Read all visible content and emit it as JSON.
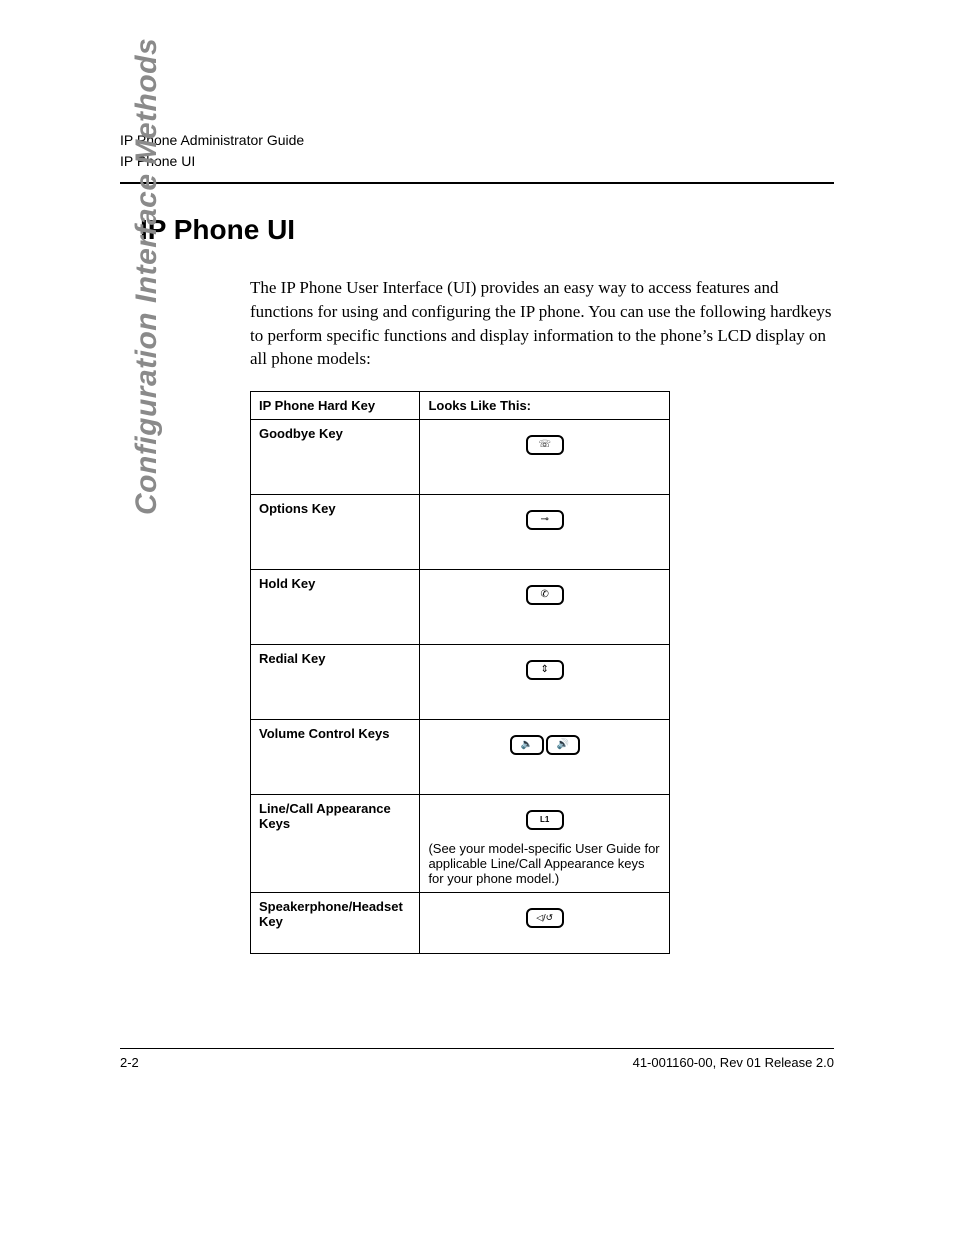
{
  "header": {
    "line1": "IP Phone Administrator Guide",
    "line2": "IP Phone UI"
  },
  "sidebar_label": "Configuration Interface Methods",
  "page_title": "IP Phone UI",
  "body_paragraph": "The IP Phone User Interface (UI) provides an easy way to access features and functions for using and configuring the IP phone. You can use the following hardkeys to perform specific functions and display information to the phone’s LCD display on all phone models:",
  "table": {
    "col1_header": "IP Phone Hard Key",
    "col2_header": "Looks Like This:",
    "rows": [
      {
        "label": "Goodbye Key",
        "icon": "goodbye",
        "note": ""
      },
      {
        "label": "Options Key",
        "icon": "options",
        "note": ""
      },
      {
        "label": "Hold Key",
        "icon": "hold",
        "note": ""
      },
      {
        "label": "Redial Key",
        "icon": "redial",
        "note": ""
      },
      {
        "label": "Volume Control Keys",
        "icon": "volume",
        "note": ""
      },
      {
        "label": "Line/Call Appearance Keys",
        "icon": "line",
        "note": "(See your model-specific User Guide for applicable Line/Call Appearance keys for your phone model.)"
      },
      {
        "label": "Speakerphone/Headset Key",
        "icon": "speaker",
        "note": ""
      }
    ]
  },
  "footer": {
    "left": "2-2",
    "right": "41-001160-00, Rev 01 Release 2.0"
  },
  "icons": {
    "goodbye_glyph": "☏",
    "options_glyph": "⊸",
    "hold_glyph": "✆",
    "redial_glyph": "⇕",
    "vol_down_glyph": "🔈",
    "vol_up_glyph": "🔊",
    "line_glyph": "L1",
    "speaker_glyph": "◁/↺"
  }
}
